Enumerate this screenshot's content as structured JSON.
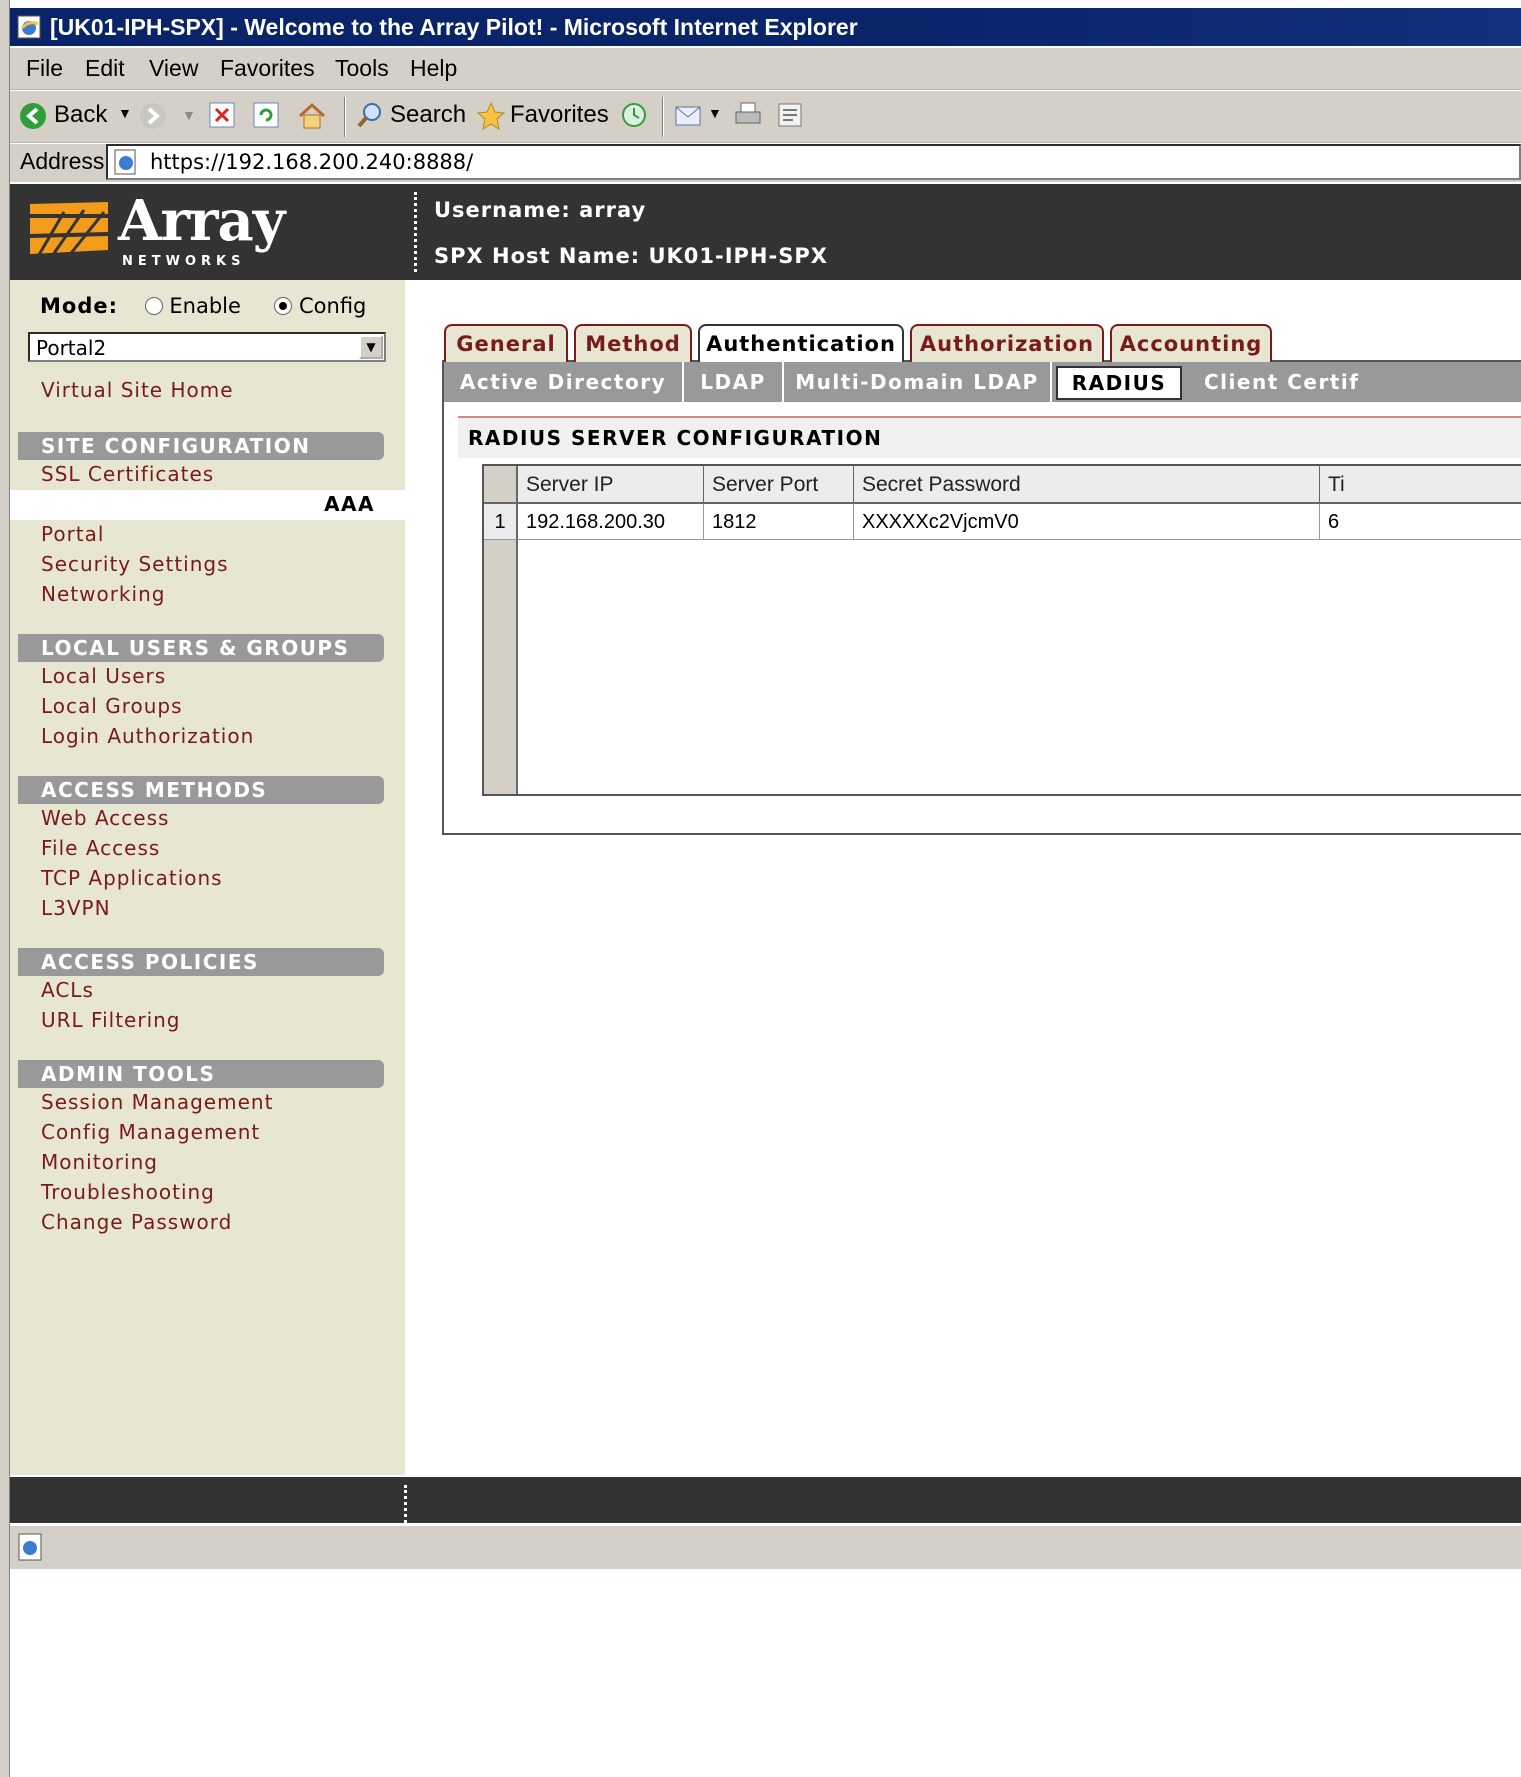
{
  "window": {
    "title": "[UK01-IPH-SPX] - Welcome to the Array Pilot! - Microsoft Internet Explorer"
  },
  "menu": [
    "File",
    "Edit",
    "View",
    "Favorites",
    "Tools",
    "Help"
  ],
  "toolbar": {
    "back_label": "Back",
    "search_label": "Search",
    "favorites_label": "Favorites"
  },
  "address": {
    "label": "Address",
    "url": "https://192.168.200.240:8888/"
  },
  "header": {
    "logo_text": "Array",
    "logo_subtext": "NETWORKS",
    "username": "Username: array",
    "hostname": "SPX Host Name: UK01-IPH-SPX"
  },
  "sidebar": {
    "mode_label": "Mode:",
    "mode_enable": "Enable",
    "mode_config": "Config",
    "selected_portal": "Portal2",
    "virtual_site_home": "Virtual Site Home",
    "site_config": {
      "title": "SITE CONFIGURATION",
      "items": [
        "SSL Certificates"
      ]
    },
    "aaa_label": "AAA",
    "portal_items": [
      "Portal",
      "Security Settings",
      "Networking"
    ],
    "local_users": {
      "title": "LOCAL USERS & GROUPS",
      "items": [
        "Local Users",
        "Local Groups",
        "Login Authorization"
      ]
    },
    "access_methods": {
      "title": "ACCESS METHODS",
      "items": [
        "Web Access",
        "File Access",
        "TCP Applications",
        "L3VPN"
      ]
    },
    "access_policies": {
      "title": "ACCESS POLICIES",
      "items": [
        "ACLs",
        "URL Filtering"
      ]
    },
    "admin_tools": {
      "title": "ADMIN TOOLS",
      "items": [
        "Session Management",
        "Config Management",
        "Monitoring",
        "Troubleshooting",
        "Change Password"
      ]
    }
  },
  "tabs": {
    "primary": [
      "General",
      "Method",
      "Authentication",
      "Authorization",
      "Accounting"
    ],
    "primary_active": "Authentication",
    "secondary": [
      "Active Directory",
      "LDAP",
      "Multi-Domain LDAP",
      "RADIUS",
      "Client Certif"
    ],
    "secondary_active": "RADIUS"
  },
  "section_title": "RADIUS SERVER CONFIGURATION",
  "grid": {
    "columns": [
      "Server IP",
      "Server Port",
      "Secret Password",
      "Ti"
    ],
    "rows": [
      {
        "num": "1",
        "server_ip": "192.168.200.30",
        "server_port": "1812",
        "secret_password": "XXXXXc2VjcmV0",
        "timeout": "6"
      }
    ]
  },
  "colors": {
    "link": "#7a1a1a",
    "header_bg": "#333333",
    "sidebar_bg": "#e6e6d2",
    "section_bg": "#999999",
    "logo_orange": "#f39c1c"
  }
}
